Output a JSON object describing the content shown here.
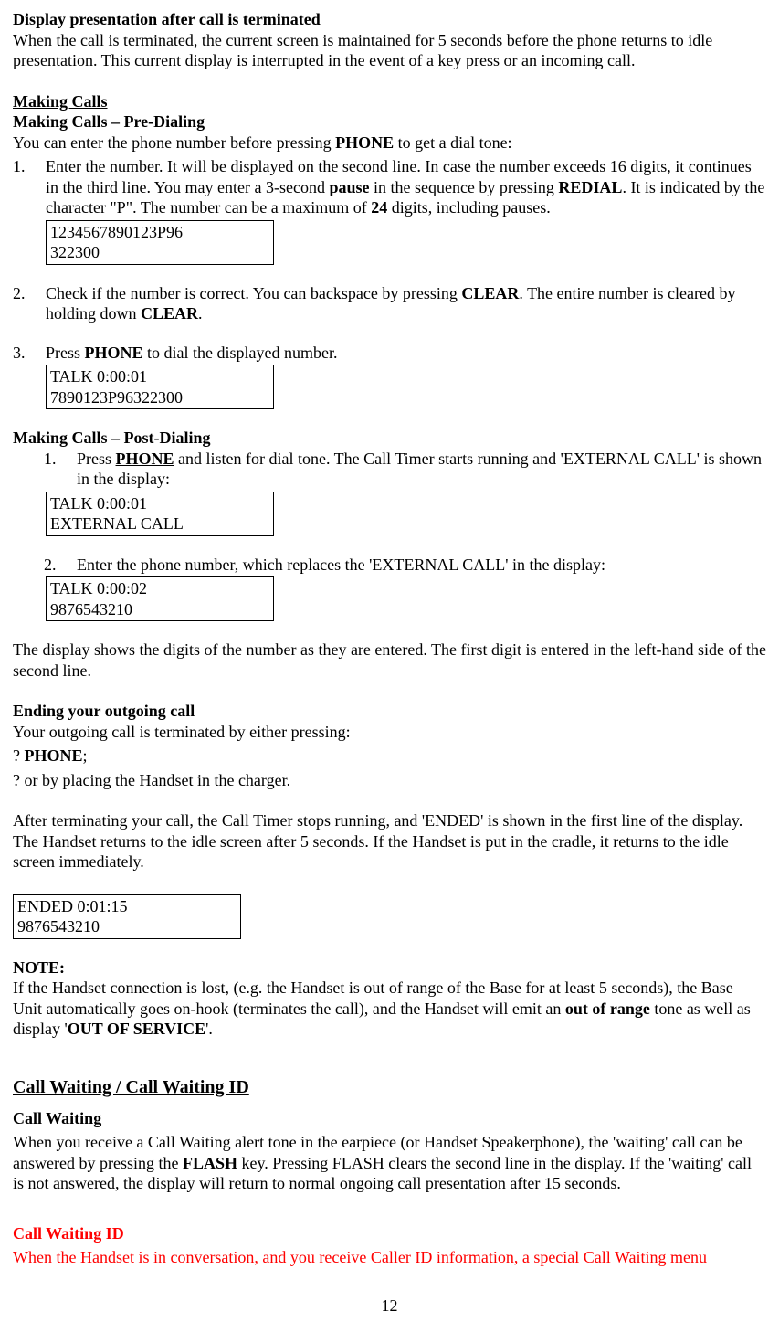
{
  "sec_display_after_call": {
    "heading": "Display presentation after call is terminated",
    "body": "When the call is terminated, the current screen is maintained for 5 seconds before the phone returns to idle presentation. This current display is interrupted in the event of a key press or an incoming call."
  },
  "sec_making_calls": {
    "heading": "Making Calls",
    "pre_dialing": {
      "heading": "Making Calls – Pre-Dialing",
      "intro_before": "You can enter the phone number before pressing ",
      "intro_phone": "PHONE",
      "intro_after": " to get a dial tone:",
      "item1_a": "Enter the number.  It will be displayed on the second line. In case the number exceeds 16 digits, it continues in the third line. You may enter a 3-second ",
      "item1_pause": "pause",
      "item1_b": " in the sequence by pressing  ",
      "item1_redial": "REDIAL",
      "item1_c": ".  It is indicated by the character \"P\".  The number can be a maximum of ",
      "item1_24": "24",
      "item1_d": " digits, including pauses.",
      "display1_l1": "1234567890123P96",
      "display1_l2": "322300",
      "item2_a": "Check if the number is correct. You can backspace by pressing ",
      "item2_clear1": "CLEAR",
      "item2_b": ". The entire number is cleared by holding down ",
      "item2_clear2": "CLEAR",
      "item2_c": ".",
      "item3_a": "Press ",
      "item3_phone": "PHONE",
      "item3_b": " to dial the displayed number.",
      "display3_l1": "TALK 0:00:01",
      "display3_l2": "7890123P96322300"
    },
    "post_dialing": {
      "heading": "Making Calls – Post-Dialing",
      "item1_a": "Press ",
      "item1_phone": "PHONE",
      "item1_b": " and listen for dial tone.  The Call Timer starts running and 'EXTERNAL CALL' is shown in the display:",
      "display1_l1": "TALK 0:00:01",
      "display1_l2": "EXTERNAL CALL",
      "item2": "Enter the phone number, which replaces the 'EXTERNAL CALL' in the display:",
      "display2_l1": "TALK 0:00:02",
      "display2_l2": "9876543210",
      "after": "The display shows the digits of the number as they are entered. The first digit is entered in the left-hand side of the second line."
    }
  },
  "sec_ending": {
    "heading": "Ending your outgoing call",
    "line1": "Your outgoing call is terminated by either pressing:",
    "bullet1_prefix": "?",
    "bullet1_phone": "PHONE",
    "bullet1_suffix": ";",
    "bullet2_prefix": "?",
    "bullet2_text": "or by placing the Handset in the charger.",
    "after": "After terminating your call, the Call Timer stops running, and 'ENDED' is shown in the first line of the display. The Handset returns to the idle screen after 5 seconds. If the Handset is put in the cradle, it returns to the idle screen immediately.",
    "display_l1": "ENDED 0:01:15",
    "display_l2": "9876543210"
  },
  "sec_note": {
    "heading": "NOTE:",
    "a": "If the Handset connection is lost, (e.g. the Handset is out of range of  the Base for at least 5 seconds), the Base Unit automatically goes on-hook (terminates the call), and the Handset will emit an ",
    "out_of_range": "out of range",
    "b": " tone as well as display '",
    "out_of_service": "OUT OF SERVICE",
    "c": "'."
  },
  "sec_cw": {
    "heading": "Call Waiting / Call Waiting ID",
    "cw_heading": "Call Waiting",
    "cw_body_a": "When you receive a Call Waiting alert tone in the earpiece (or Handset Speakerphone), the 'waiting' call can be answered by pressing the ",
    "cw_flash": "FLASH",
    "cw_body_b": " key. Pressing FLASH clears the second line in the display. If the 'waiting' call is not answered, the display will return to normal ongoing call presentation after 15 seconds.",
    "cwid_heading": "Call Waiting ID",
    "cwid_body": "When the Handset is in conversation, and you receive Caller ID information, a special Call Waiting menu"
  },
  "page_number": "12"
}
